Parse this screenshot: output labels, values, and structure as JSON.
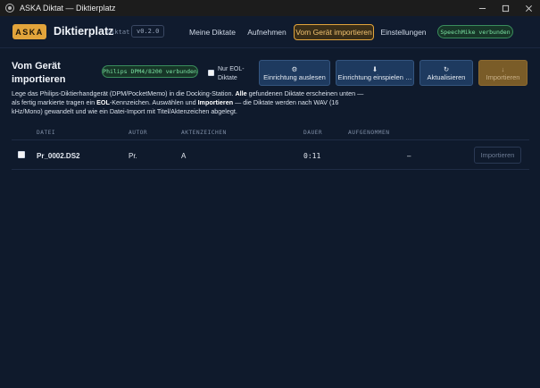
{
  "window": {
    "title": "ASKA Diktat — Diktierplatz"
  },
  "header": {
    "logo": "ASKA",
    "app_title": "Diktierplatz",
    "app_subtitle": "Diktat",
    "version": "v0.2.0",
    "nav": [
      {
        "label": "Meine Diktate",
        "active": false
      },
      {
        "label": "Aufnehmen",
        "active": false
      },
      {
        "label": "Vom Gerät importieren",
        "active": true
      },
      {
        "label": "Einstellungen",
        "active": false
      }
    ],
    "status": "SpeechMike verbunden"
  },
  "section": {
    "title": "Vom Gerät importieren",
    "device_badge": "Philips DPM4/8200 verbunden",
    "eol_label": "Nur EOL-Diktate",
    "eol_checked": false,
    "actions": {
      "read_config": {
        "icon": "⚙",
        "label": "Einrichtung auslesen"
      },
      "apply_config": {
        "icon": "⬇",
        "label": "Einrichtung einspielen …"
      },
      "refresh": {
        "icon": "↻",
        "label": "Aktualisieren"
      },
      "import": {
        "icon": "↓",
        "label": "Importieren"
      }
    },
    "description": {
      "p1": "Lege das Philips-Diktierhandgerät (DPM/PocketMemo) in die Docking-Station. ",
      "b1": "Alle",
      "p2": " gefundenen Diktate erscheinen unten — als fertig markierte tragen ein ",
      "b2": "EOL",
      "p3": "-Kennzeichen. Auswählen und ",
      "b3": "Importieren",
      "p4": " — die Diktate werden nach WAV (16 kHz/Mono) gewandelt und wie ein Datei-Import mit Titel/Aktenzeichen abgelegt."
    }
  },
  "table": {
    "headers": {
      "file": "DATEI",
      "author": "AUTOR",
      "reference": "AKTENZEICHEN",
      "duration": "DAUER",
      "recorded": "AUFGENOMMEN"
    },
    "rows": [
      {
        "file": "Pr_0002.DS2",
        "author": "Pr.",
        "reference": "A",
        "duration": "0:11",
        "recorded": "–",
        "action": "Importieren",
        "checked": false
      }
    ]
  },
  "colors": {
    "accent": "#e2a43b",
    "success": "#7be3a3",
    "button": "#1e3a5f",
    "background": "#0f1a2c"
  }
}
